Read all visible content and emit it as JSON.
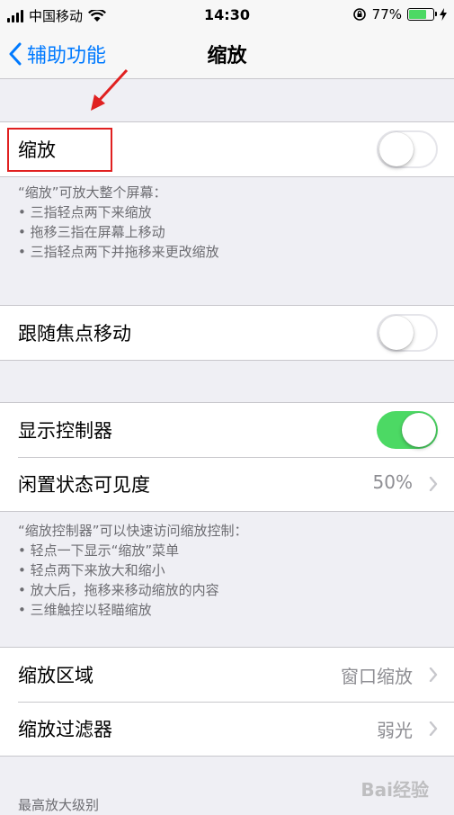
{
  "status_bar": {
    "carrier": "中国移动",
    "time": "14:30",
    "battery_percent": "77%",
    "battery_level": 0.77,
    "icons": [
      "signal-icon",
      "wifi-icon",
      "orientation-lock-icon",
      "battery-icon",
      "charging-icon"
    ]
  },
  "nav": {
    "back_label": "辅助功能",
    "title": "缩放"
  },
  "zoom": {
    "label": "缩放",
    "toggle_on": false
  },
  "zoom_footer": {
    "title": "“缩放”可放大整个屏幕：",
    "items": [
      "• 三指轻点两下来缩放",
      "• 拖移三指在屏幕上移动",
      "• 三指轻点两下并拖移来更改缩放"
    ]
  },
  "follow_focus": {
    "label": "跟随焦点移动",
    "toggle_on": false
  },
  "controller": {
    "show_label": "显示控制器",
    "show_on": true,
    "idle_label": "闲置状态可见度",
    "idle_value": "50%"
  },
  "controller_footer": {
    "title": "“缩放控制器”可以快速访问缩放控制：",
    "items": [
      "• 轻点一下显示“缩放”菜单",
      "• 轻点两下来放大和缩小",
      "• 放大后，拖移来移动缩放的内容",
      "• 三维触控以轻瞄缩放"
    ]
  },
  "region": {
    "label": "缩放区域",
    "value": "窗口缩放"
  },
  "filter": {
    "label": "缩放过滤器",
    "value": "弱光"
  },
  "max_zoom_header": "最高放大级别",
  "watermark": "Bai经验",
  "colors": {
    "accent": "#007aff",
    "toggle_on": "#4cd964",
    "annotation": "#e02020"
  }
}
